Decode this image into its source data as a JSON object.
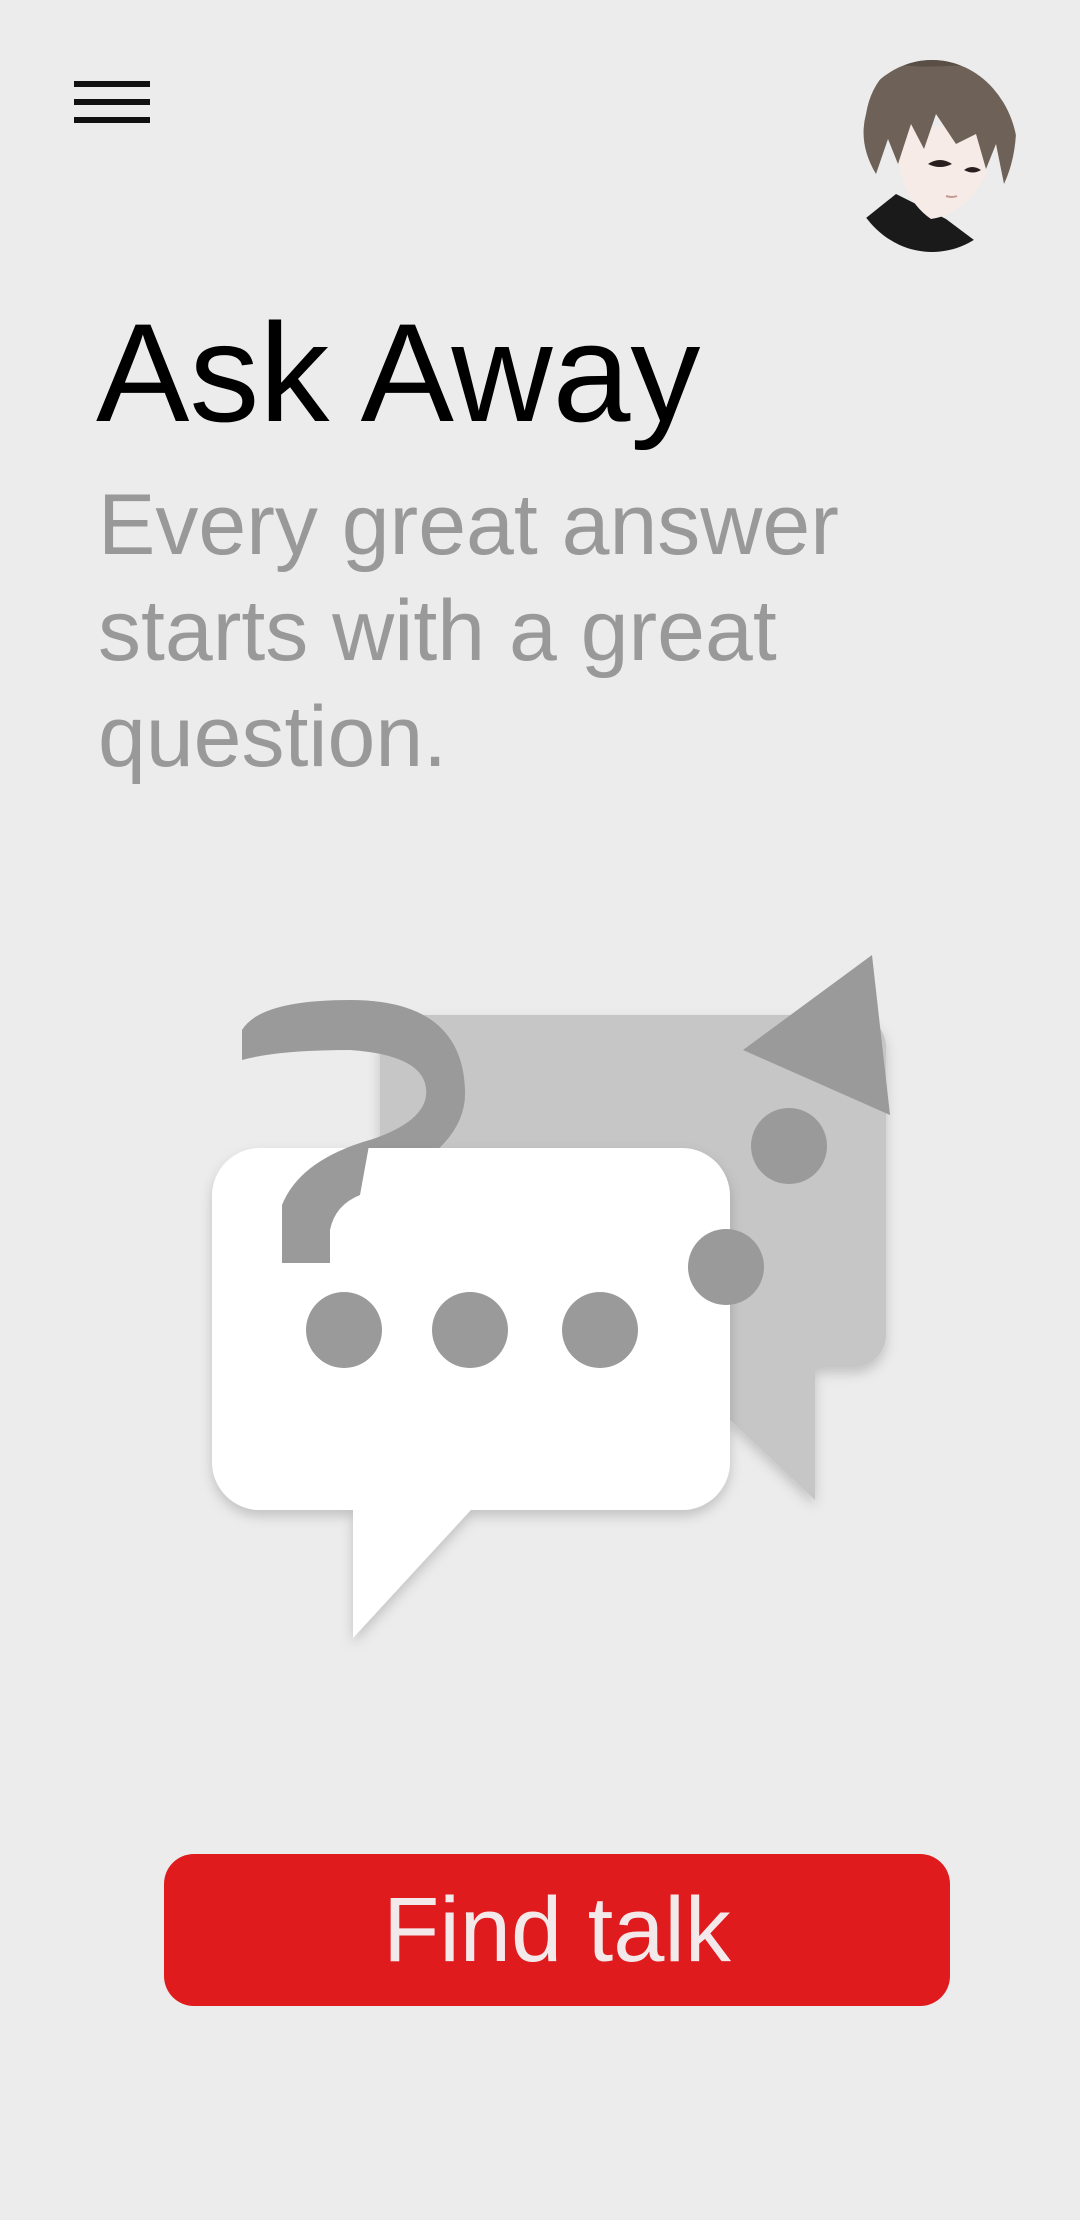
{
  "header": {
    "menu_icon": "hamburger-menu-icon",
    "avatar_icon": "anime-boy-avatar"
  },
  "hero": {
    "title": "Ask Away",
    "subtitle": "Every great answer starts with a great question."
  },
  "illustration": {
    "icon": "question-chat-bubbles-icon"
  },
  "cta": {
    "label": "Find talk"
  },
  "colors": {
    "background": "#ececec",
    "accent": "#e01b1e",
    "subtitle": "#999999",
    "illustration_gray": "#9a9a9a",
    "bubble_back": "#c6c6c6",
    "bubble_front": "#ffffff"
  }
}
